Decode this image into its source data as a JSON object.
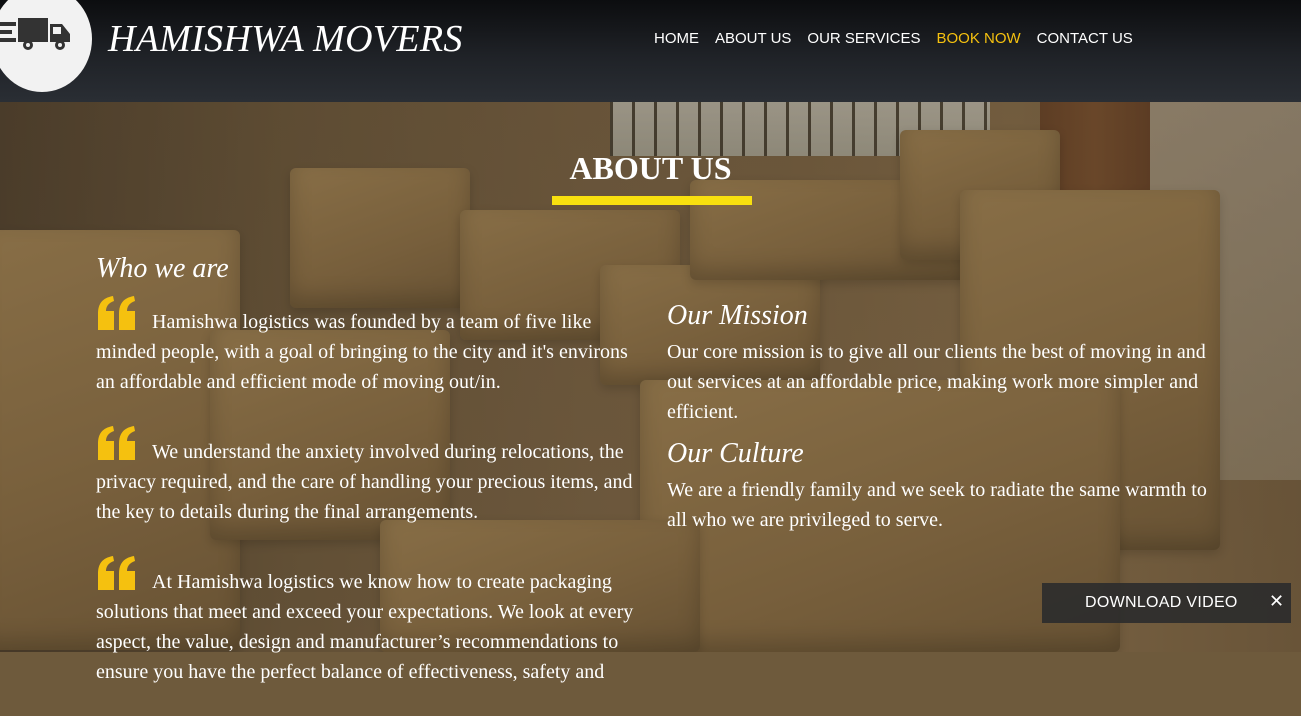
{
  "header": {
    "site_title": "HAMISHWA MOVERS",
    "logo_icon": "truck-icon"
  },
  "nav": {
    "items": [
      {
        "label": "HOME"
      },
      {
        "label": "ABOUT US"
      },
      {
        "label": "OUR SERVICES"
      },
      {
        "label": "BOOK NOW"
      },
      {
        "label": "CONTACT US"
      }
    ],
    "active_index": 3,
    "active_color": "#f5c10f"
  },
  "about": {
    "title": "ABOUT US",
    "underline_color": "#f8e00f",
    "who_we_are": {
      "heading": "Who we are",
      "quotes": [
        "Hamishwa logistics was founded by a team of five like minded people, with a goal of bringing to the city and it's environs an affordable and efficient mode of moving out/in.",
        "We understand the anxiety involved during relocations, the privacy required, and the care of handling your precious items, and the key to details during the final arrangements.",
        "At Hamishwa logistics we know how to create packaging solutions that meet and exceed your expectations. We look at every aspect, the value, design and manufacturer’s recommendations to ensure you have the perfect balance of effectiveness, safety and"
      ],
      "quote_icon": "quote-icon",
      "quote_color": "#f5c10f"
    },
    "mission": {
      "heading": "Our Mission",
      "text": "Our core mission is to give all our clients the best of moving in and out services at an affordable price, making work more simpler and efficient."
    },
    "culture": {
      "heading": "Our Culture",
      "text": "We are a friendly family and we seek to radiate the same warmth to all who we are privileged to serve."
    }
  },
  "download_bar": {
    "label": "DOWNLOAD VIDEO",
    "close_glyph": "✕"
  }
}
